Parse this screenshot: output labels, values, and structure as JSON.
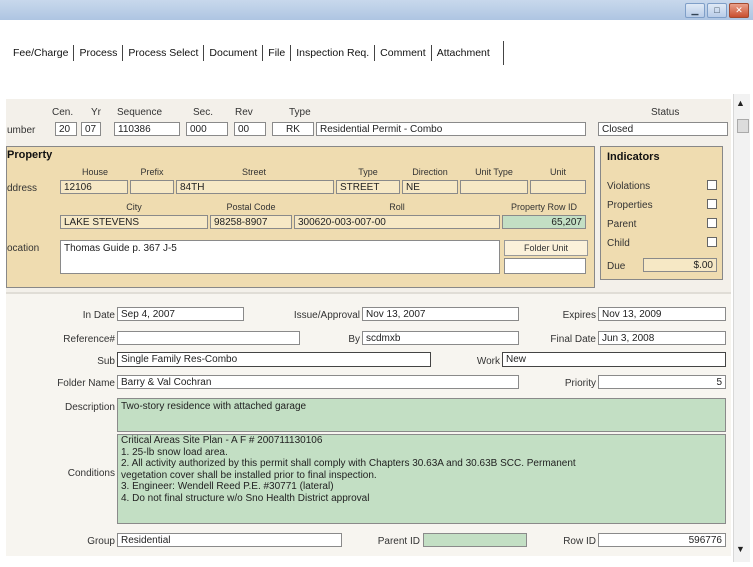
{
  "window": {
    "buttons": {
      "minimize": "▁",
      "maximize": "□",
      "close": "✕"
    }
  },
  "tabs": [
    "Fee/Charge",
    "Process",
    "Process Select",
    "Document",
    "File",
    "Inspection Req.",
    "Comment",
    "Attachment"
  ],
  "header": {
    "number_label": "umber",
    "cen_label": "Cen.",
    "cen": "20",
    "yr_label": "Yr",
    "yr": "07",
    "sequence_label": "Sequence",
    "sequence": "110386",
    "sec_label": "Sec.",
    "sec": "000",
    "rev_label": "Rev",
    "rev": "00",
    "type_label": "Type",
    "type_code": "RK",
    "type_desc": "Residential Permit - Combo",
    "status_label": "Status",
    "status": "Closed"
  },
  "property": {
    "title": "Property",
    "address_label": "ddress",
    "house_label": "House",
    "house": "12106",
    "prefix_label": "Prefix",
    "prefix": "",
    "street_label": "Street",
    "street": "84TH",
    "stype_label": "Type",
    "stype": "STREET",
    "direction_label": "Direction",
    "direction": "NE",
    "unit_type_label": "Unit Type",
    "unit_type": "",
    "unit_label": "Unit",
    "unit": "",
    "city_label": "City",
    "city": "LAKE STEVENS",
    "postal_label": "Postal Code",
    "postal": "98258-8907",
    "roll_label": "Roll",
    "roll": "300620-003-007-00",
    "rowid_label": "Property Row ID",
    "rowid": "65,207",
    "location_label": "ocation",
    "location": "Thomas Guide p. 367 J-5",
    "folder_unit_label": "Folder Unit"
  },
  "indicators": {
    "title": "Indicators",
    "items": [
      "Violations",
      "Properties",
      "Parent",
      "Child"
    ],
    "due_label": "Due",
    "due": "$.00"
  },
  "details": {
    "in_date_label": "In Date",
    "in_date": "Sep 4, 2007",
    "issue_label": "Issue/Approval",
    "issue": "Nov 13, 2007",
    "expires_label": "Expires",
    "expires": "Nov 13, 2009",
    "reference_label": "Reference#",
    "reference": "",
    "by_label": "By",
    "by": "scdmxb",
    "final_label": "Final Date",
    "final": "Jun 3, 2008",
    "sub_label": "Sub",
    "sub": "Single Family Res-Combo",
    "work_label": "Work",
    "work": "New",
    "folder_name_label": "Folder Name",
    "folder_name": "Barry & Val Cochran",
    "priority_label": "Priority",
    "priority": "5",
    "description_label": "Description",
    "description": "Two-story residence with attached garage",
    "conditions_label": "Conditions",
    "conditions": [
      "Critical Areas Site Plan - A F # 200711130106",
      "1. 25-lb snow load area.",
      "2. All activity authorized by this permit shall comply with Chapters 30.63A and 30.63B SCC. Permanent",
      "vegetation cover shall be installed prior to final inspection.",
      "3. Engineer: Wendell Reed P.E. #30771 (lateral)",
      "4. Do not final structure w/o Sno Health District approval"
    ],
    "group_label": "Group",
    "group": "Residential",
    "parent_id_label": "Parent ID",
    "parent_id": "",
    "row_id_label": "Row ID",
    "row_id": "596776"
  },
  "colors": {
    "tan": "#efdcb0",
    "green": "#c3dfc4",
    "titlebar": "#aec5e2"
  }
}
